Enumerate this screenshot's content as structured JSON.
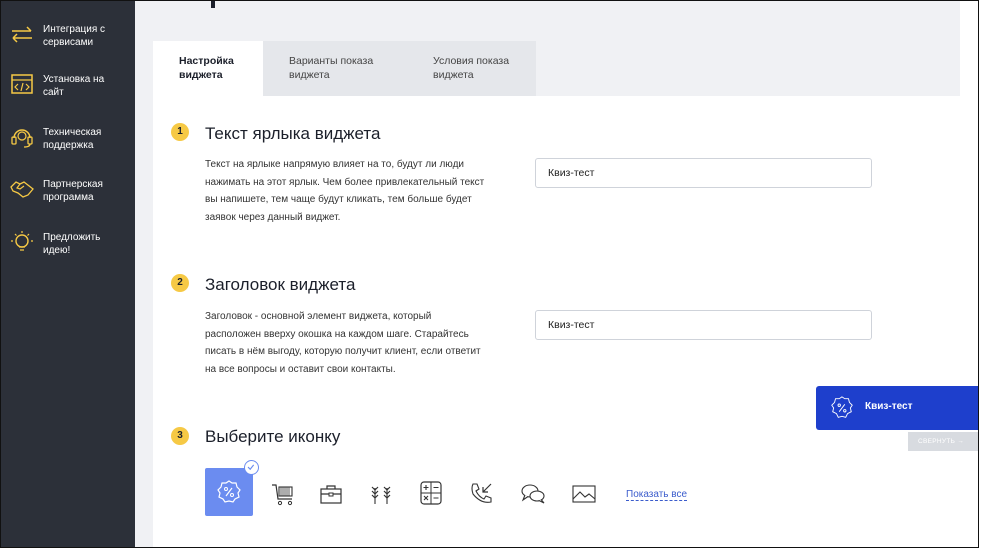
{
  "sidebar": {
    "items": [
      {
        "label": "Интеграция с\nсервисами",
        "icon": "arrows-exchange-icon"
      },
      {
        "label": "Установка на\nсайт",
        "icon": "code-window-icon"
      },
      {
        "label": "Техническая\nподдержка",
        "icon": "headset-icon"
      },
      {
        "label": "Партнерская\nпрограмма",
        "icon": "handshake-icon"
      },
      {
        "label": "Предложить\nидею!",
        "icon": "lightbulb-icon"
      }
    ]
  },
  "tabs": [
    {
      "label": "Настройка\nвиджета",
      "active": true
    },
    {
      "label": "Варианты показа\nвиджета",
      "active": false
    },
    {
      "label": "Условия показа\nвиджета",
      "active": false
    }
  ],
  "steps": [
    {
      "num": "1",
      "title": "Текст ярлыка виджета",
      "desc": "Текст на ярлыке напрямую влияет на то, будут ли люди нажимать на этот ярлык. Чем более привлекательный текст вы напишете, тем чаще будут кликать, тем больше будет заявок через данный виджет.",
      "value": "Квиз-тест"
    },
    {
      "num": "2",
      "title": "Заголовок виджета",
      "desc": "Заголовок - основной элемент виджета, который расположен вверху окошка на каждом шаге. Старайтесь писать в нём выгоду, которую получит клиент, если ответит на все вопросы и оставит свои контакты.",
      "value": "Квиз-тест"
    },
    {
      "num": "3",
      "title": "Выберите иконку"
    }
  ],
  "icons": {
    "selected": "percent-badge-icon",
    "options": [
      "cart-icon",
      "briefcase-icon",
      "wheat-icon",
      "calculator-icon",
      "phone-incoming-icon",
      "chat-bubbles-icon",
      "image-icon"
    ],
    "show_all": "Показать все"
  },
  "widget": {
    "label": "Квиз-тест",
    "collapse": "СВЕРНУТЬ →"
  },
  "colors": {
    "sidebar_bg": "#2c3039",
    "accent_yellow": "#f6c945",
    "widget_blue": "#1e3fcc",
    "selected_icon_bg": "#6b8cf0",
    "link_blue": "#3b5ccc"
  }
}
